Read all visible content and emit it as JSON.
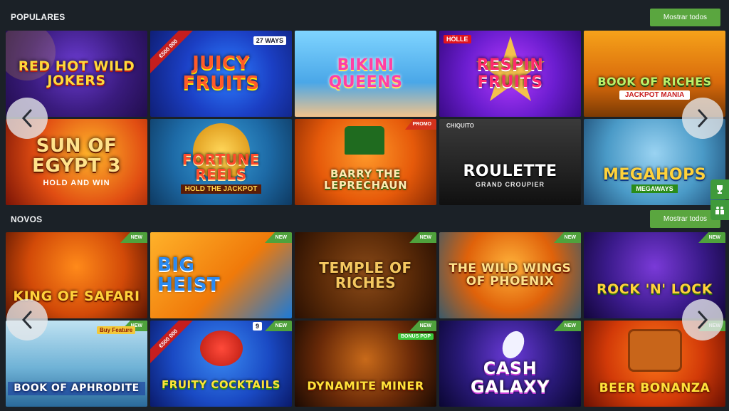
{
  "popular": {
    "title": "POPULARES",
    "show_all_label": "Mostrar todos",
    "games": [
      {
        "name": "Red Hot Wild Jokers"
      },
      {
        "name": "Juicy Fruits",
        "corner": "€500 000",
        "tag": "27 WAYS"
      },
      {
        "name": "Bikini Queens"
      },
      {
        "name": "Respin Fruits",
        "tag": "HÖLLE"
      },
      {
        "name": "Book of Riches",
        "subtitle": "JACKPOT MANIA"
      },
      {
        "name": "Sun of Egypt 3",
        "subtitle": "HOLD AND WIN"
      },
      {
        "name": "Fortune Reels",
        "subtitle": "HOLD THE JACKPOT"
      },
      {
        "name": "Barry the Leprechaun",
        "badge": "PROMO"
      },
      {
        "name": "Roulette",
        "subtitle": "GRAND CROUPIER",
        "tag": "CHIQUITO"
      },
      {
        "name": "Megahops",
        "subtitle": "MEGAWAYS"
      }
    ]
  },
  "new": {
    "title": "NOVOS",
    "show_all_label": "Mostrar todos",
    "badge": "NEW",
    "games": [
      {
        "name": "King of Safari"
      },
      {
        "name": "Big Heist"
      },
      {
        "name": "Temple of Riches"
      },
      {
        "name": "The Wild Wings of Phoenix"
      },
      {
        "name": "Rock 'n' Lock"
      },
      {
        "name": "Book of Aphrodite",
        "tag": "Buy Feature"
      },
      {
        "name": "Fruity Cocktails",
        "corner": "€500 000",
        "tag": "9"
      },
      {
        "name": "Dynamite Miner",
        "tag": "BONUS POP"
      },
      {
        "name": "Cash Galaxy"
      },
      {
        "name": "Beer Bonanza"
      }
    ]
  },
  "colors": {
    "accent": "#5aa63f",
    "background": "#1b2127",
    "new_badge": "#4fa23c",
    "promo_badge": "#d4321c"
  },
  "icons": [
    "chevron-left-icon",
    "chevron-right-icon",
    "trophy-icon",
    "tournament-icon"
  ]
}
